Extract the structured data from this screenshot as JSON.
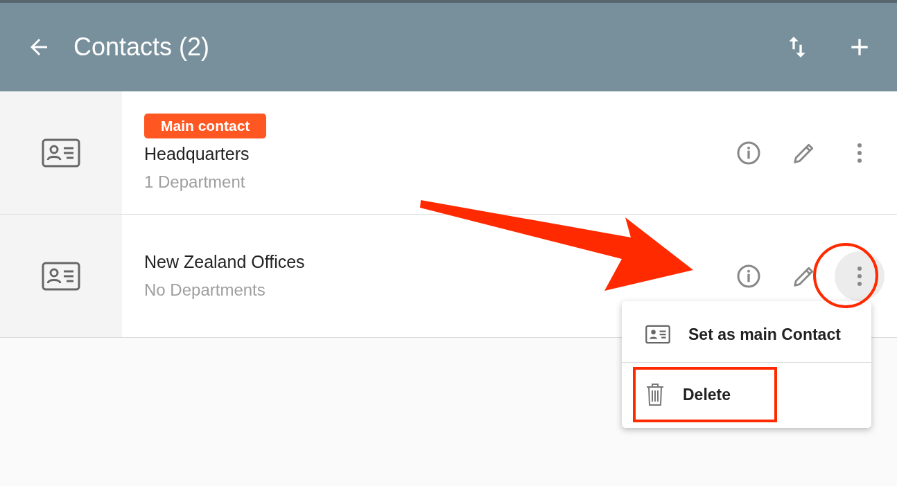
{
  "header": {
    "title": "Contacts (2)"
  },
  "contacts": [
    {
      "badge": "Main contact",
      "title": "Headquarters",
      "subtitle": "1 Department",
      "menu_open": false
    },
    {
      "title": "New Zealand Offices",
      "subtitle": "No Departments",
      "menu_open": true
    }
  ],
  "menu": {
    "items": [
      {
        "kind": "card",
        "label": "Set as main Contact",
        "highlighted": false
      },
      {
        "kind": "trash",
        "label": "Delete",
        "highlighted": true
      }
    ]
  }
}
